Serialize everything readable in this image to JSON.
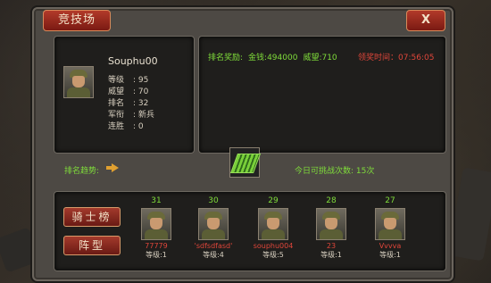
{
  "window": {
    "title": "竞技场",
    "close_label": "X"
  },
  "player": {
    "name": "Souphu00",
    "stats": [
      {
        "label": "等级",
        "value": "95"
      },
      {
        "label": "威望",
        "value": "70"
      },
      {
        "label": "排名",
        "value": "32"
      },
      {
        "label": "军衔",
        "value": "新兵"
      },
      {
        "label": "连胜",
        "value": "0"
      }
    ]
  },
  "rewards": {
    "label": "排名奖励:",
    "gold": "金钱:494000",
    "prestige": "威望:710",
    "countdown_label": "领奖时间：",
    "countdown_value": "07:56:05"
  },
  "trend": {
    "label": "排名趋势:"
  },
  "challenge": {
    "label": "今日可挑战次数:",
    "count": "15次"
  },
  "buttons": {
    "knight": "骑士榜",
    "formation": "阵型"
  },
  "opponents": [
    {
      "rank": "31",
      "name": "77779",
      "level": "等级:1"
    },
    {
      "rank": "30",
      "name": "'sdfsdfasd'",
      "level": "等级:4"
    },
    {
      "rank": "29",
      "name": "souphu004",
      "level": "等级:5"
    },
    {
      "rank": "28",
      "name": "23",
      "level": "等级:1"
    },
    {
      "rank": "27",
      "name": "Vvvva",
      "level": "等级:1"
    }
  ],
  "colors": {
    "accent_green": "#7fdc3a",
    "accent_red": "#e0463a",
    "button_red": "#a33a2c"
  }
}
